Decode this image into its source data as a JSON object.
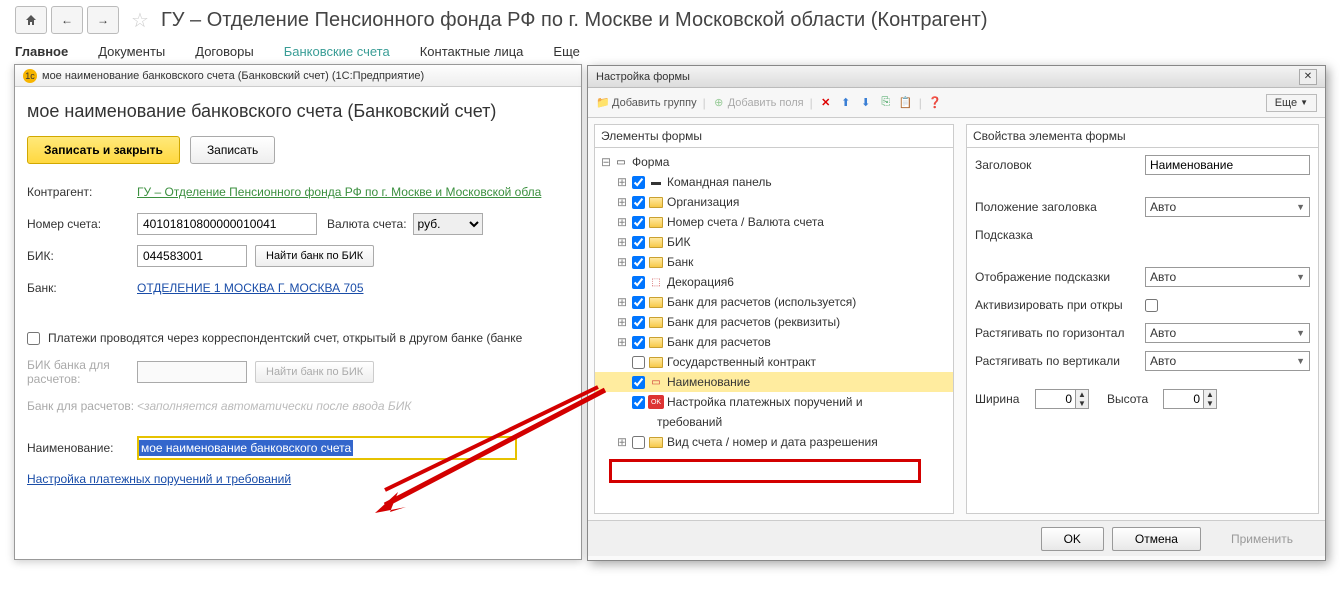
{
  "top": {
    "page_title": "ГУ – Отделение Пенсионного фонда РФ по г. Москве и Московской области (Контрагент)"
  },
  "tabs": {
    "main": "Главное",
    "docs": "Документы",
    "contracts": "Договоры",
    "bank": "Банковские счета",
    "contacts": "Контактные лица",
    "more": "Еще"
  },
  "modal1": {
    "win_title": "мое наименование банковского счета (Банковский счет)   (1С:Предприятие)",
    "heading": "мое наименование банковского счета (Банковский счет)",
    "save_close": "Записать и закрыть",
    "save": "Записать",
    "f_counterparty": "Контрагент:",
    "v_counterparty": "ГУ – Отделение Пенсионного фонда РФ по г. Москве и Московской обла",
    "f_account": "Номер счета:",
    "v_account": "40101810800000010041",
    "f_currency": "Валюта счета:",
    "v_currency": "руб.",
    "f_bik": "БИК:",
    "v_bik": "044583001",
    "b_find_bank": "Найти банк по БИК",
    "f_bank": "Банк:",
    "v_bank": "ОТДЕЛЕНИЕ 1 МОСКВА Г. МОСКВА 705",
    "chk_corr_text": "Платежи проводятся через корреспондентский счет, открытый в другом банке (банке",
    "f_bik2": "БИК банка для расчетов:",
    "f_bank2": "Банк для расчетов:",
    "ph_bank2": "<заполняется автоматически после ввода БИК",
    "f_name": "Наименование:",
    "v_name": "мое наименование банковского счета",
    "link_payment": "Настройка платежных поручений и требований"
  },
  "modal2": {
    "title": "Настройка формы",
    "tb_add_group": "Добавить группу",
    "tb_add_fields": "Добавить поля",
    "tb_more": "Еще",
    "left_head": "Элементы формы",
    "right_head": "Свойства элемента формы",
    "footer_ok": "OK",
    "footer_cancel": "Отмена",
    "footer_apply": "Применить",
    "tree": {
      "root": "Форма",
      "i1": "Командная панель",
      "i2": "Организация",
      "i3": "Номер счета / Валюта счета",
      "i4": "БИК",
      "i5": "Банк",
      "i6": "Декорация6",
      "i7": "Банк для расчетов (используется)",
      "i8": "Банк для расчетов (реквизиты)",
      "i9": "Банк для расчетов",
      "i10": "Государственный контракт",
      "i11": "Наименование",
      "i12a": "Настройка платежных поручений и",
      "i12b": "требований",
      "i13": "Вид счета / номер и дата разрешения"
    },
    "props": {
      "p_title": "Заголовок",
      "v_title": "Наименование",
      "p_title_pos": "Положение заголовка",
      "v_auto": "Авто",
      "p_hint": "Подсказка",
      "p_hint_disp": "Отображение подсказки",
      "p_activate": "Активизировать при откры",
      "p_stretch_h": "Растягивать по горизонтал",
      "p_stretch_v": "Растягивать по вертикали",
      "p_width": "Ширина",
      "p_height": "Высота",
      "v_zero": "0"
    }
  }
}
